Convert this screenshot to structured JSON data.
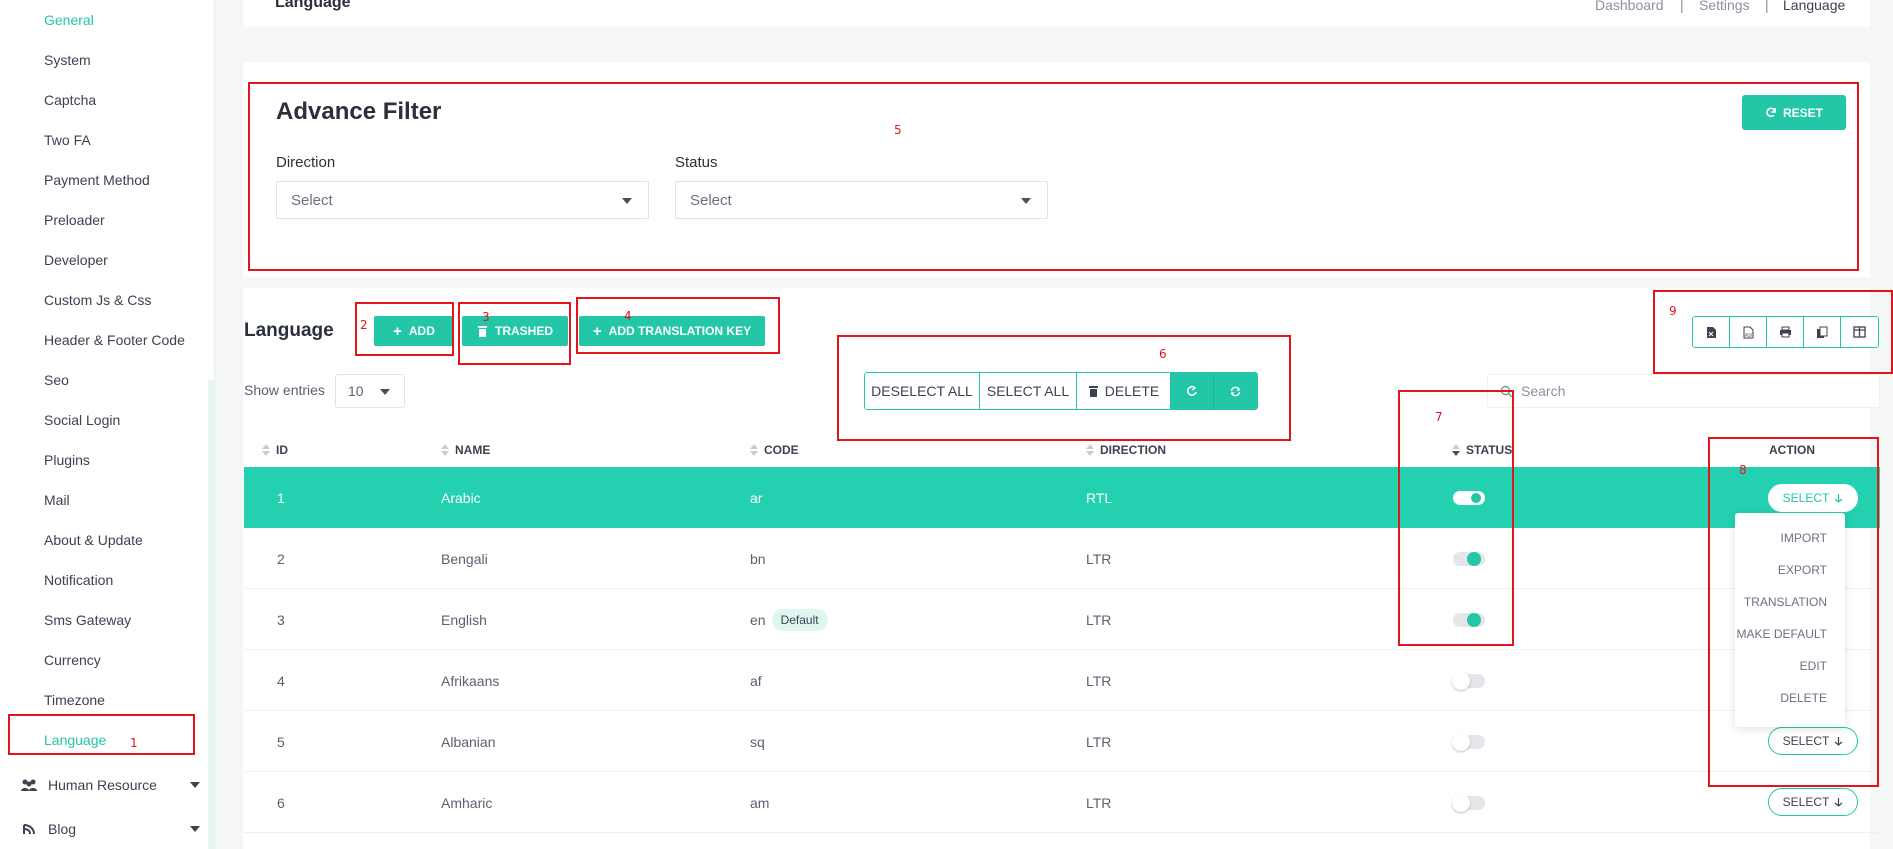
{
  "sidebar": {
    "items": [
      "General",
      "System",
      "Captcha",
      "Two FA",
      "Payment Method",
      "Preloader",
      "Developer",
      "Custom Js & Css",
      "Header & Footer Code",
      "Seo",
      "Social Login",
      "Plugins",
      "Mail",
      "About & Update",
      "Notification",
      "Sms Gateway",
      "Currency",
      "Timezone",
      "Language"
    ],
    "groups": [
      "Human Resource",
      "Blog"
    ]
  },
  "header": {
    "title": "Language",
    "breadcrumb": [
      "Dashboard",
      "Settings",
      "Language"
    ],
    "sep": "|"
  },
  "filter": {
    "title": "Advance Filter",
    "reset_label": "RESET",
    "direction_label": "Direction",
    "status_label": "Status",
    "direction_value": "Select",
    "status_value": "Select"
  },
  "toolbar": {
    "title": "Language",
    "add_label": "ADD",
    "trashed_label": "TRASHED",
    "add_key_label": "ADD TRANSLATION KEY",
    "show_entries": "Show entries",
    "entries_value": "10",
    "deselect_all": "DESELECT ALL",
    "select_all": "SELECT ALL",
    "delete_label": "DELETE",
    "search_placeholder": "Search"
  },
  "table": {
    "headers": [
      "ID",
      "NAME",
      "CODE",
      "DIRECTION",
      "STATUS",
      "ACTION"
    ],
    "rows": [
      {
        "id": "1",
        "name": "Arabic",
        "code": "ar",
        "badge": "",
        "direction": "RTL",
        "status": "on",
        "action": "SELECT"
      },
      {
        "id": "2",
        "name": "Bengali",
        "code": "bn",
        "badge": "",
        "direction": "LTR",
        "status": "on",
        "action": ""
      },
      {
        "id": "3",
        "name": "English",
        "code": "en",
        "badge": "Default",
        "direction": "LTR",
        "status": "on",
        "action": ""
      },
      {
        "id": "4",
        "name": "Afrikaans",
        "code": "af",
        "badge": "",
        "direction": "LTR",
        "status": "off",
        "action": ""
      },
      {
        "id": "5",
        "name": "Albanian",
        "code": "sq",
        "badge": "",
        "direction": "LTR",
        "status": "off",
        "action": "SELECT"
      },
      {
        "id": "6",
        "name": "Amharic",
        "code": "am",
        "badge": "",
        "direction": "LTR",
        "status": "off",
        "action": "SELECT"
      }
    ]
  },
  "action_menu": [
    "IMPORT",
    "EXPORT",
    "TRANSLATION",
    "MAKE DEFAULT",
    "EDIT",
    "DELETE"
  ],
  "annotations": [
    "1",
    "2",
    "3",
    "4",
    "5",
    "6",
    "7",
    "8",
    "9"
  ],
  "colors": {
    "accent": "#23c7a7",
    "annotation": "#e3141c"
  }
}
